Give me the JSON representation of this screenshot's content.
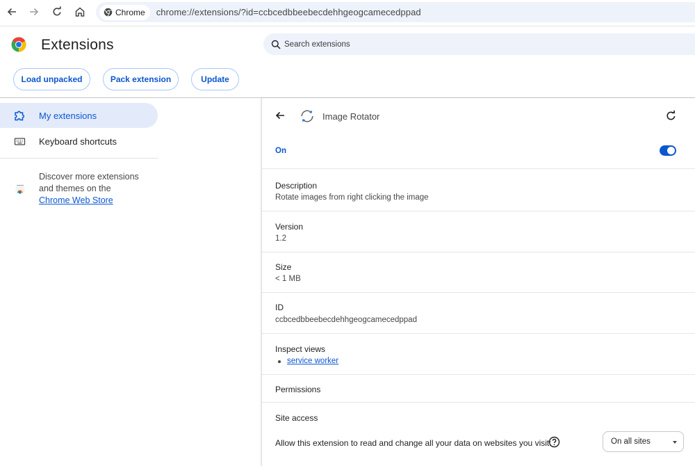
{
  "browser": {
    "chip_label": "Chrome",
    "url": "chrome://extensions/?id=ccbcedbbeebecdehhgeogcamecedppad"
  },
  "header": {
    "title": "Extensions",
    "search_placeholder": "Search extensions"
  },
  "toolbar_buttons": {
    "load_unpacked": "Load unpacked",
    "pack_extension": "Pack extension",
    "update": "Update"
  },
  "sidebar": {
    "items": [
      {
        "label": "My extensions",
        "active": true,
        "icon": "puzzle-icon"
      },
      {
        "label": "Keyboard shortcuts",
        "active": false,
        "icon": "keyboard-icon"
      }
    ],
    "discover_line1": "Discover more extensions",
    "discover_line2": "and themes on the",
    "store_link": "Chrome Web Store"
  },
  "detail": {
    "extension_name": "Image Rotator",
    "on_label": "On",
    "toggle_on": true,
    "description_label": "Description",
    "description_value": "Rotate images from right clicking the image",
    "version_label": "Version",
    "version_value": "1.2",
    "size_label": "Size",
    "size_value": "< 1 MB",
    "id_label": "ID",
    "id_value": "ccbcedbbeebecdehhgeogcamecedppad",
    "inspect_label": "Inspect views",
    "inspect_link": "service worker",
    "permissions_label": "Permissions",
    "site_access_label": "Site access",
    "site_access_text": "Allow this extension to read and change all your data on websites you visit:",
    "site_access_selected": "On all sites"
  },
  "colors": {
    "accent": "#0b57d0",
    "active_bg": "#e3ebfb",
    "omnibox_bg": "#eef2fb"
  }
}
